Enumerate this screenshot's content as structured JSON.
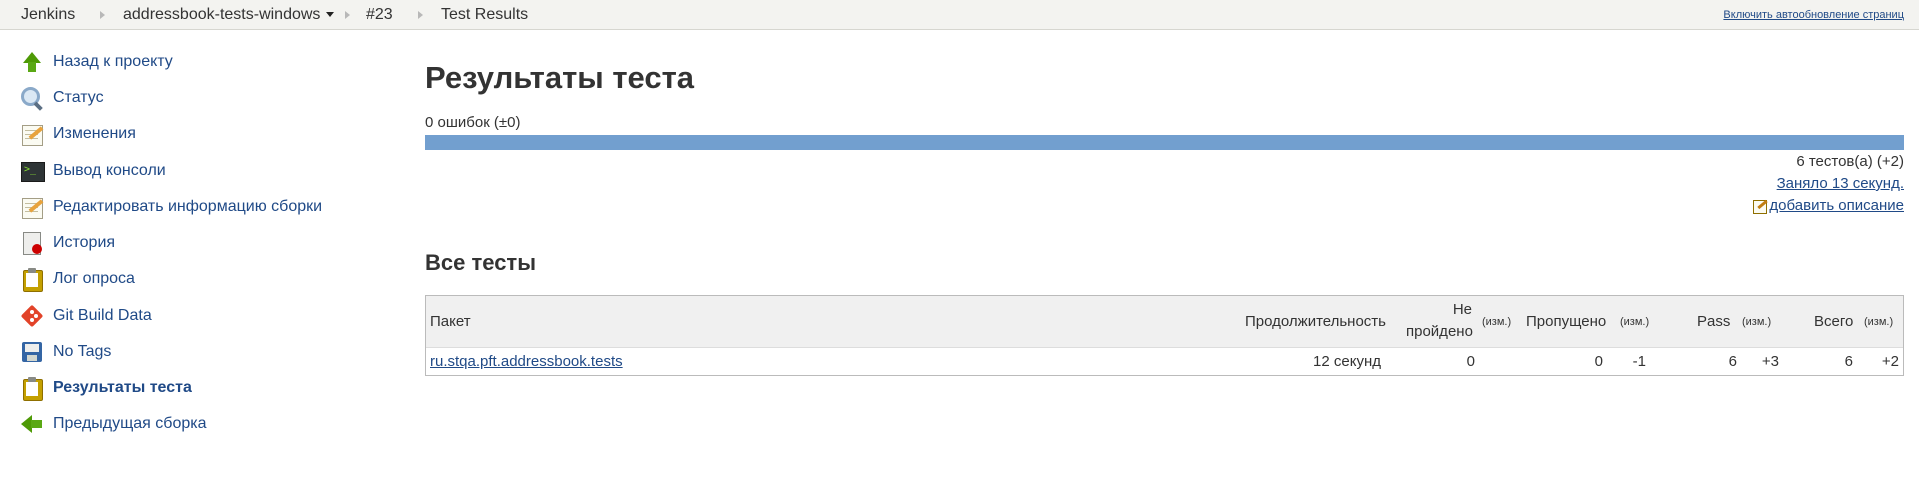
{
  "breadcrumbs": {
    "items": [
      "Jenkins",
      "addressbook-tests-windows",
      "#23",
      "Test Results"
    ],
    "autorefresh": "Включить автообновление страниц"
  },
  "sidebar": {
    "items": [
      {
        "label": "Назад к проекту",
        "icon": "up-arrow-icon"
      },
      {
        "label": "Статус",
        "icon": "search-icon"
      },
      {
        "label": "Изменения",
        "icon": "notepad-icon"
      },
      {
        "label": "Вывод консоли",
        "icon": "terminal-icon"
      },
      {
        "label": "Редактировать информацию сборки",
        "icon": "notepad-icon"
      },
      {
        "label": "История",
        "icon": "history-icon"
      },
      {
        "label": "Лог опроса",
        "icon": "clipboard-icon"
      },
      {
        "label": "Git Build Data",
        "icon": "git-icon"
      },
      {
        "label": "No Tags",
        "icon": "save-icon"
      },
      {
        "label": "Результаты теста",
        "icon": "clipboard-icon",
        "active": true
      },
      {
        "label": "Предыдущая сборка",
        "icon": "left-arrow-icon"
      }
    ]
  },
  "main": {
    "title": "Результаты теста",
    "errors": "0 ошибок (±0)",
    "progress_pass_fraction": 1.0,
    "tests_count": "6 тестов(а) (+2)",
    "took": "Заняло 13 секунд.",
    "add_description": "добавить описание",
    "all_tests_title": "Все тесты"
  },
  "table": {
    "headers": {
      "package": "Пакет",
      "duration": "Продолжительность",
      "failed_line1": "Не",
      "failed_line2": "пройдено",
      "diff": "(изм.)",
      "skipped": "Пропущено",
      "pass": "Pass",
      "total": "Всего"
    },
    "rows": [
      {
        "package": "ru.stqa.pft.addressbook.tests",
        "duration": "12 секунд",
        "failed": "0",
        "failed_diff": "",
        "skipped": "0",
        "skipped_diff": "-1",
        "pass": "6",
        "pass_diff": "+3",
        "total": "6",
        "total_diff": "+2"
      }
    ]
  },
  "colors": {
    "link": "#204a87",
    "progress_pass": "#729fcf"
  }
}
